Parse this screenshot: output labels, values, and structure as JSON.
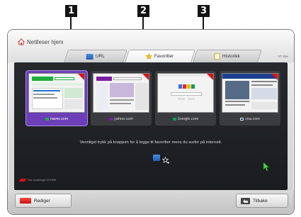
{
  "callouts": [
    "1",
    "2",
    "3"
  ],
  "window": {
    "title": "Nettleser hjem",
    "site_label": "VT Site"
  },
  "tabs": [
    {
      "label": "URL",
      "icon": "url-icon",
      "active": false
    },
    {
      "label": "Favoritter",
      "icon": "star-icon",
      "active": true
    },
    {
      "label": "Historikk",
      "icon": "history-icon",
      "active": false
    }
  ],
  "favorites": [
    {
      "label": "naver.com",
      "selected": true
    },
    {
      "label": "yahoo.com",
      "selected": false
    },
    {
      "label": "Google.com",
      "selected": false
    },
    {
      "label": "voa.com",
      "selected": false
    }
  ],
  "message": "Vennligst trykk på knappen for å legge til favoritter mens du surfer på internett.",
  "legend_text": "Vise innstillinger til HJEM",
  "buttons": {
    "edit_label": "Rediger",
    "back_label": "Tilbake"
  },
  "colors": {
    "selected": "#6c3fb8",
    "panel": "#1f2124",
    "corner_mark": "#dd1111",
    "red_key": "#e01b1b",
    "blue_key": "#2f74cf"
  }
}
